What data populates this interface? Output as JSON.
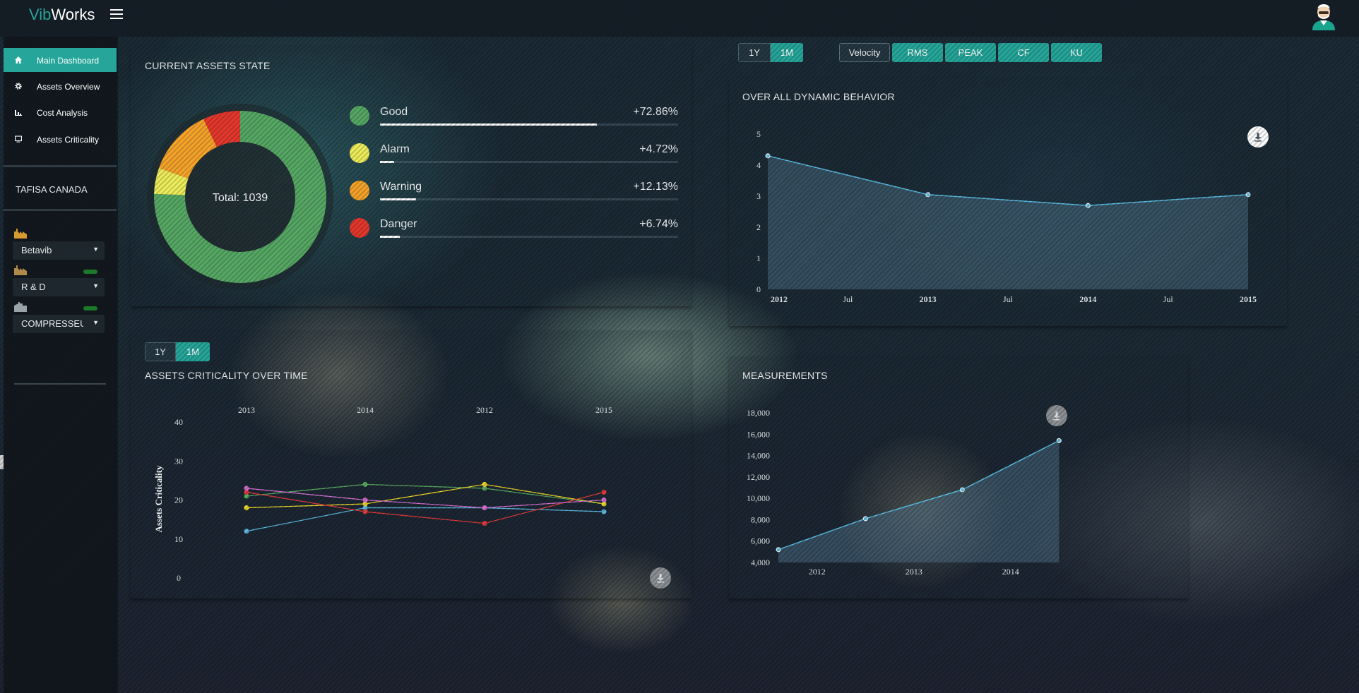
{
  "app": {
    "logo_part1": "Vib",
    "logo_part2": "Works",
    "accent": "#26a69a"
  },
  "sidebar": {
    "items": [
      {
        "label": "Main Dashboard",
        "icon": "home-icon",
        "active": true
      },
      {
        "label": "Assets Overview",
        "icon": "gear-icon",
        "active": false
      },
      {
        "label": "Cost Analysis",
        "icon": "bar-chart-icon",
        "active": false
      },
      {
        "label": "Assets Criticality",
        "icon": "monitor-icon",
        "active": false
      }
    ],
    "site": "TAFISA CANADA",
    "selects": [
      {
        "value": "Betavib",
        "icon": "factory-icon"
      },
      {
        "value": "R & D",
        "icon": "factory-icon"
      },
      {
        "value": "COMPRESSEUR",
        "icon": "building-icon"
      }
    ]
  },
  "assets_state": {
    "title": "CURRENT ASSETS STATE",
    "total_label": "Total: 1039",
    "items": [
      {
        "name": "Good",
        "pct": "+72.86%",
        "value": 72.86,
        "color": "#56a864"
      },
      {
        "name": "Alarm",
        "pct": "+4.72%",
        "value": 4.72,
        "color": "#eeed5a"
      },
      {
        "name": "Warning",
        "pct": "+12.13%",
        "value": 12.13,
        "color": "#f5a32a"
      },
      {
        "name": "Danger",
        "pct": "+6.74%",
        "value": 6.74,
        "color": "#e4382c"
      }
    ]
  },
  "controls": {
    "period_top": [
      "1Y",
      "1M"
    ],
    "period_top_active": "1M",
    "metrics": [
      "Velocity",
      "RMS",
      "PEAK",
      "CF",
      "KU"
    ],
    "metric_active": "Velocity",
    "period_bottom": [
      "1Y",
      "1M"
    ],
    "period_bottom_active": "1M"
  },
  "dynamic_behavior": {
    "title": "OVER ALL DYNAMIC BEHAVIOR"
  },
  "criticality": {
    "title": "ASSETS CRITICALITY OVER TIME"
  },
  "measurements": {
    "title": "MEASUREMENTS"
  },
  "chart_data": [
    {
      "type": "area",
      "title": "OVER ALL DYNAMIC BEHAVIOR",
      "x_ticks": [
        "2012",
        "Jul",
        "2013",
        "Jul",
        "2014",
        "Jul",
        "2015"
      ],
      "x": [
        "2012",
        "2013",
        "2014",
        "2015"
      ],
      "values": [
        4.3,
        3.05,
        2.7,
        3.05
      ],
      "ylim": [
        0,
        5
      ],
      "y_ticks": [
        "0",
        "1",
        "2",
        "3",
        "4",
        "5"
      ],
      "color": "#5bbde4"
    },
    {
      "type": "line",
      "title": "ASSETS CRITICALITY OVER TIME",
      "ylabel": "Assets Criticality",
      "categories": [
        "2013",
        "2014",
        "2012",
        "2015"
      ],
      "ylim": [
        0,
        40
      ],
      "y_ticks": [
        "0",
        "10",
        "20",
        "30",
        "40"
      ],
      "series": [
        {
          "values": [
            12,
            18,
            18,
            17
          ],
          "color": "#5cb6e0"
        },
        {
          "values": [
            21,
            24,
            23,
            19
          ],
          "color": "#58a860"
        },
        {
          "values": [
            18,
            19,
            24,
            19
          ],
          "color": "#f0d72a"
        },
        {
          "values": [
            22,
            17,
            14,
            22
          ],
          "color": "#e23a3a"
        },
        {
          "values": [
            23,
            20,
            18,
            20
          ],
          "color": "#d46ed0"
        }
      ]
    },
    {
      "type": "area",
      "title": "MEASUREMENTS",
      "x_ticks": [
        "2012",
        "2013",
        "2014"
      ],
      "x": [
        2011.6,
        2012.5,
        2013.5,
        2014.5
      ],
      "values": [
        5200,
        8100,
        10800,
        15400
      ],
      "ylim": [
        4000,
        18000
      ],
      "y_ticks": [
        "4,000",
        "6,000",
        "8,000",
        "10,000",
        "12,000",
        "14,000",
        "16,000",
        "18,000"
      ],
      "color": "#5bbde4"
    }
  ]
}
